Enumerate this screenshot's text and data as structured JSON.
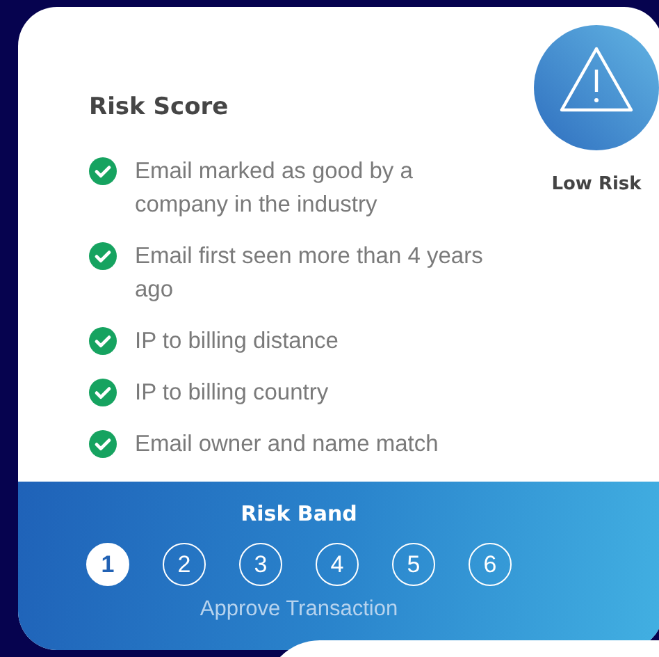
{
  "risk_score": {
    "title": "Risk Score",
    "badge_label": "Low Risk",
    "checks": [
      {
        "text": "Email marked as good by a company in the industry",
        "checked": true
      },
      {
        "text": "Email first seen more than 4 years ago",
        "checked": true
      },
      {
        "text": "IP to billing distance",
        "checked": true
      },
      {
        "text": "IP to billing country",
        "checked": true
      },
      {
        "text": "Email owner and name match",
        "checked": true
      }
    ]
  },
  "risk_band": {
    "title": "Risk Band",
    "bands": [
      {
        "label": "1",
        "selected": true
      },
      {
        "label": "2",
        "selected": false
      },
      {
        "label": "3",
        "selected": false
      },
      {
        "label": "4",
        "selected": false
      },
      {
        "label": "5",
        "selected": false
      },
      {
        "label": "6",
        "selected": false
      }
    ],
    "caption": "Approve Transaction"
  }
}
